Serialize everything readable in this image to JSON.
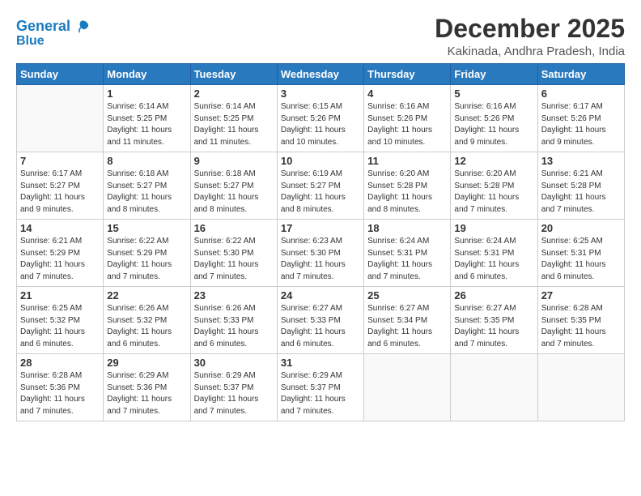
{
  "header": {
    "logo_line1": "General",
    "logo_line2": "Blue",
    "month_title": "December 2025",
    "location": "Kakinada, Andhra Pradesh, India"
  },
  "weekdays": [
    "Sunday",
    "Monday",
    "Tuesday",
    "Wednesday",
    "Thursday",
    "Friday",
    "Saturday"
  ],
  "weeks": [
    [
      {
        "day": "",
        "empty": true
      },
      {
        "day": "1",
        "sunrise": "6:14 AM",
        "sunset": "5:25 PM",
        "daylight": "11 hours and 11 minutes."
      },
      {
        "day": "2",
        "sunrise": "6:14 AM",
        "sunset": "5:25 PM",
        "daylight": "11 hours and 11 minutes."
      },
      {
        "day": "3",
        "sunrise": "6:15 AM",
        "sunset": "5:26 PM",
        "daylight": "11 hours and 10 minutes."
      },
      {
        "day": "4",
        "sunrise": "6:16 AM",
        "sunset": "5:26 PM",
        "daylight": "11 hours and 10 minutes."
      },
      {
        "day": "5",
        "sunrise": "6:16 AM",
        "sunset": "5:26 PM",
        "daylight": "11 hours and 9 minutes."
      },
      {
        "day": "6",
        "sunrise": "6:17 AM",
        "sunset": "5:26 PM",
        "daylight": "11 hours and 9 minutes."
      }
    ],
    [
      {
        "day": "7",
        "sunrise": "6:17 AM",
        "sunset": "5:27 PM",
        "daylight": "11 hours and 9 minutes."
      },
      {
        "day": "8",
        "sunrise": "6:18 AM",
        "sunset": "5:27 PM",
        "daylight": "11 hours and 8 minutes."
      },
      {
        "day": "9",
        "sunrise": "6:18 AM",
        "sunset": "5:27 PM",
        "daylight": "11 hours and 8 minutes."
      },
      {
        "day": "10",
        "sunrise": "6:19 AM",
        "sunset": "5:27 PM",
        "daylight": "11 hours and 8 minutes."
      },
      {
        "day": "11",
        "sunrise": "6:20 AM",
        "sunset": "5:28 PM",
        "daylight": "11 hours and 8 minutes."
      },
      {
        "day": "12",
        "sunrise": "6:20 AM",
        "sunset": "5:28 PM",
        "daylight": "11 hours and 7 minutes."
      },
      {
        "day": "13",
        "sunrise": "6:21 AM",
        "sunset": "5:28 PM",
        "daylight": "11 hours and 7 minutes."
      }
    ],
    [
      {
        "day": "14",
        "sunrise": "6:21 AM",
        "sunset": "5:29 PM",
        "daylight": "11 hours and 7 minutes."
      },
      {
        "day": "15",
        "sunrise": "6:22 AM",
        "sunset": "5:29 PM",
        "daylight": "11 hours and 7 minutes."
      },
      {
        "day": "16",
        "sunrise": "6:22 AM",
        "sunset": "5:30 PM",
        "daylight": "11 hours and 7 minutes."
      },
      {
        "day": "17",
        "sunrise": "6:23 AM",
        "sunset": "5:30 PM",
        "daylight": "11 hours and 7 minutes."
      },
      {
        "day": "18",
        "sunrise": "6:24 AM",
        "sunset": "5:31 PM",
        "daylight": "11 hours and 7 minutes."
      },
      {
        "day": "19",
        "sunrise": "6:24 AM",
        "sunset": "5:31 PM",
        "daylight": "11 hours and 6 minutes."
      },
      {
        "day": "20",
        "sunrise": "6:25 AM",
        "sunset": "5:31 PM",
        "daylight": "11 hours and 6 minutes."
      }
    ],
    [
      {
        "day": "21",
        "sunrise": "6:25 AM",
        "sunset": "5:32 PM",
        "daylight": "11 hours and 6 minutes."
      },
      {
        "day": "22",
        "sunrise": "6:26 AM",
        "sunset": "5:32 PM",
        "daylight": "11 hours and 6 minutes."
      },
      {
        "day": "23",
        "sunrise": "6:26 AM",
        "sunset": "5:33 PM",
        "daylight": "11 hours and 6 minutes."
      },
      {
        "day": "24",
        "sunrise": "6:27 AM",
        "sunset": "5:33 PM",
        "daylight": "11 hours and 6 minutes."
      },
      {
        "day": "25",
        "sunrise": "6:27 AM",
        "sunset": "5:34 PM",
        "daylight": "11 hours and 6 minutes."
      },
      {
        "day": "26",
        "sunrise": "6:27 AM",
        "sunset": "5:35 PM",
        "daylight": "11 hours and 7 minutes."
      },
      {
        "day": "27",
        "sunrise": "6:28 AM",
        "sunset": "5:35 PM",
        "daylight": "11 hours and 7 minutes."
      }
    ],
    [
      {
        "day": "28",
        "sunrise": "6:28 AM",
        "sunset": "5:36 PM",
        "daylight": "11 hours and 7 minutes."
      },
      {
        "day": "29",
        "sunrise": "6:29 AM",
        "sunset": "5:36 PM",
        "daylight": "11 hours and 7 minutes."
      },
      {
        "day": "30",
        "sunrise": "6:29 AM",
        "sunset": "5:37 PM",
        "daylight": "11 hours and 7 minutes."
      },
      {
        "day": "31",
        "sunrise": "6:29 AM",
        "sunset": "5:37 PM",
        "daylight": "11 hours and 7 minutes."
      },
      {
        "day": "",
        "empty": true
      },
      {
        "day": "",
        "empty": true
      },
      {
        "day": "",
        "empty": true
      }
    ]
  ],
  "labels": {
    "sunrise_prefix": "Sunrise:",
    "sunset_prefix": "Sunset:",
    "daylight_prefix": "Daylight:"
  }
}
